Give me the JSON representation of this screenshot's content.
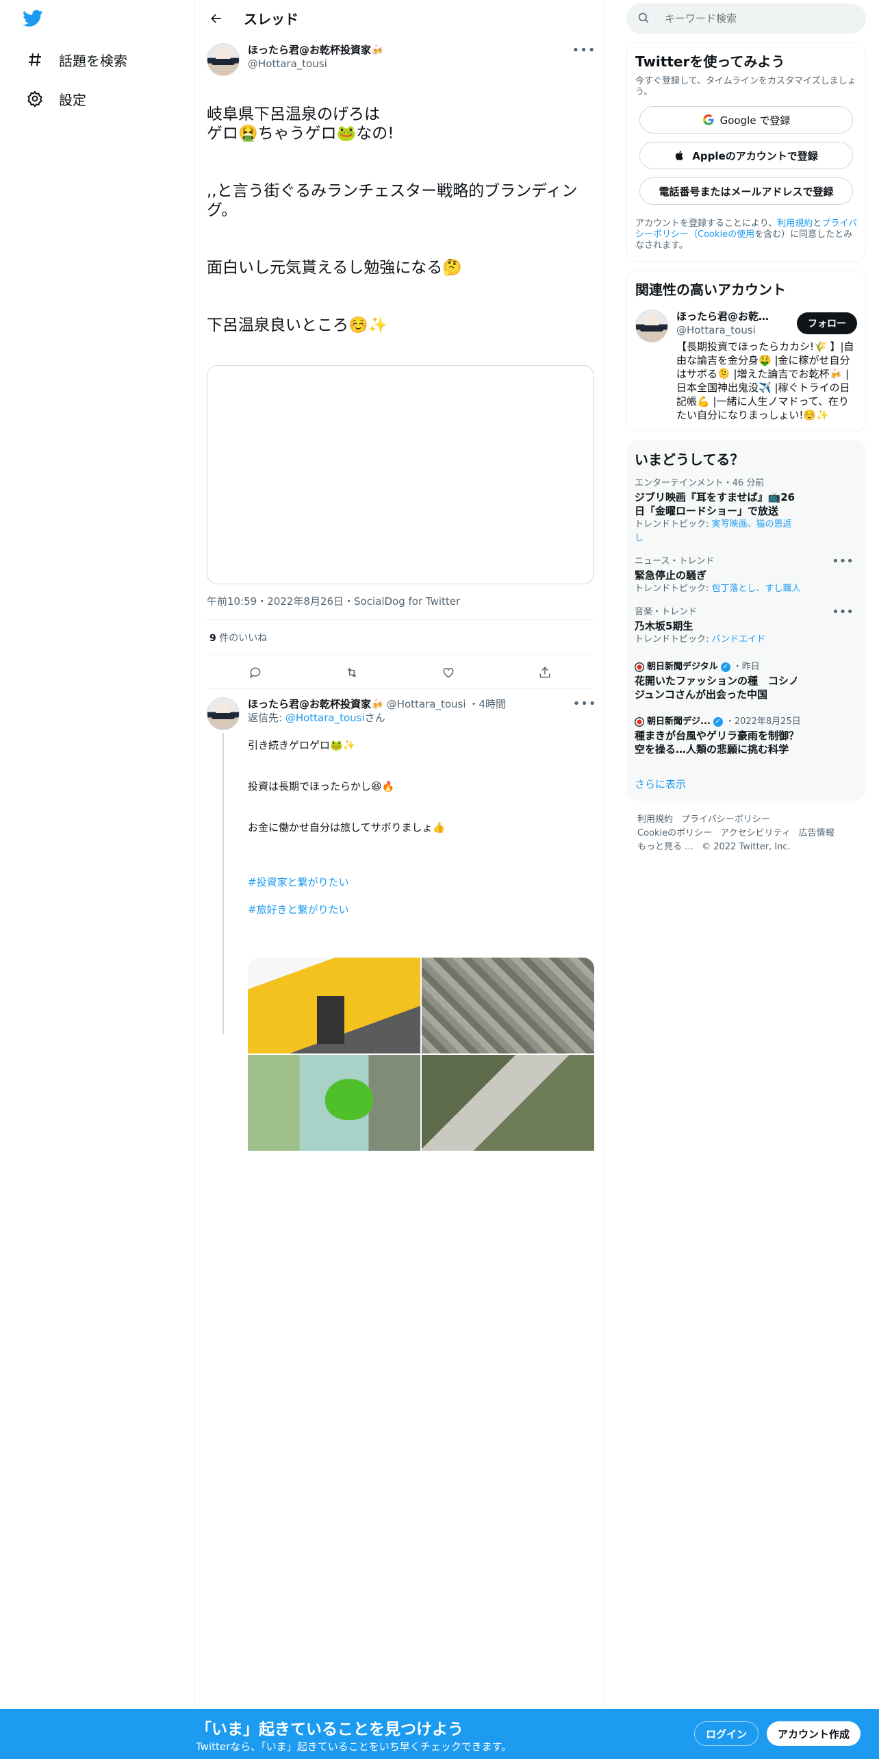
{
  "nav": {
    "explore": "話題を検索",
    "settings": "設定"
  },
  "header": {
    "title": "スレッド"
  },
  "tweet": {
    "author_name": "ほったら君@お乾杯投資家🍻",
    "author_handle": "@Hottara_tousi",
    "para1": "岐阜県下呂温泉のげろは\nゲロ🤮ちゃうゲロ🐸なの!",
    "para2": ",,と言う街ぐるみランチェスター戦略的ブランディング。",
    "para3": "面白いし元気貰えるし勉強になる🤔",
    "para4": "下呂温泉良いところ☺️✨",
    "timestamp": "午前10:59・2022年8月26日・SocialDog for Twitter",
    "likes_count": "9",
    "likes_label": "件のいいね"
  },
  "reply": {
    "author_name": "ほったら君@お乾杯投資家🍻",
    "author_handle": "@Hottara_tousi",
    "time": "・4時間",
    "reply_to_prefix": "返信先: ",
    "reply_to_handle": "@Hottara_tousi",
    "reply_to_suffix": "さん",
    "line1": "引き続きゲロゲロ🐸✨",
    "line2": "投資は長期でほったらかし😆🔥",
    "line3": "お金に働かせ自分は旅してサボりましょ👍",
    "hashtag1": "#投資家と繋がりたい",
    "hashtag2": "#旅好きと繋がりたい"
  },
  "search": {
    "placeholder": "キーワード検索"
  },
  "signup_card": {
    "title": "Twitterを使ってみよう",
    "desc": "今すぐ登録して、タイムラインをカスタマイズしましょう。",
    "google": "Google で登録",
    "apple": "Appleのアカウントで登録",
    "phone": "電話番号またはメールアドレスで登録",
    "terms_prefix": "アカウントを登録することにより、",
    "terms_link1": "利用規約",
    "terms_and": "と",
    "terms_link2": "プライバシーポリシー（Cookieの使用",
    "terms_suffix": "を含む）に同意したとみなされます。"
  },
  "related": {
    "title": "関連性の高いアカウント",
    "name": "ほったら君@お乾杯投資家🍻",
    "handle": "@Hottara_tousi",
    "bio": "【長期投資でほったらカカシ!🌾 】|自由な論吉を金分身🤑 |金に稼がせ自分はサボる🫠 |増えた論吉でお乾杯🍻 |日本全国神出鬼没✈️ |稼ぐトライの日記帳💪 |一緒に人生ノマドって、在りたい自分になりまっしょい!☺️✨",
    "follow": "フォロー"
  },
  "trends": {
    "title": "いまどうしてる？",
    "items": [
      {
        "cat": "エンターテインメント・46 分前",
        "title": "ジブリ映画『耳をすませば』📺26日「金曜ロードショー」で放送",
        "topic_prefix": "トレンドトピック: ",
        "topic": "実写映画、猫の恩返し"
      },
      {
        "cat": "ニュース・トレンド",
        "title": "緊急停止の騒ぎ",
        "topic_prefix": "トレンドトピック: ",
        "topic": "包丁落とし、すし職人"
      },
      {
        "cat": "音楽・トレンド",
        "title": "乃木坂5期生",
        "topic_prefix": "トレンドトピック: ",
        "topic": "バンドエイド"
      }
    ],
    "news": [
      {
        "source": "朝日新聞デジタル",
        "time": "・昨日",
        "title": "花開いたファッションの種　コシノジュンコさんが出会った中国"
      },
      {
        "source": "朝日新聞デジ...",
        "time": "・2022年8月25日",
        "title": "種まきが台風やゲリラ豪雨を制御？　空を操る…人類の悲願に挑む科学"
      }
    ],
    "more": "さらに表示"
  },
  "footer": {
    "l1": "利用規約",
    "l2": "プライバシーポリシー",
    "l3": "Cookieのポリシー",
    "l4": "アクセシビリティ",
    "l5": "広告情報",
    "l6": "もっと見る …",
    "copy": "© 2022 Twitter, Inc."
  },
  "bottom_bar": {
    "title": "「いま」起きていることを見つけよう",
    "subtitle": "Twitterなら、「いま」起きていることをいち早くチェックできます。",
    "login": "ログイン",
    "signup": "アカウント作成"
  },
  "colors": {
    "accent": "#1d9bf0",
    "text": "#0f1419",
    "secondary": "#536471"
  }
}
